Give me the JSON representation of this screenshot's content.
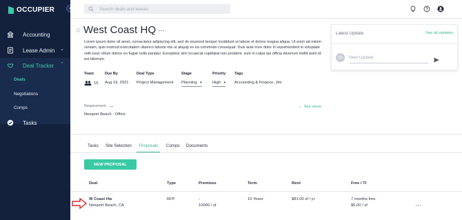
{
  "brand": {
    "name": "OCCUPIER",
    "accent": "#3bc9a5",
    "sidebar_bg": "#13213d"
  },
  "sidebar": {
    "items": [
      {
        "label": "Accounting",
        "icon": "building-icon"
      },
      {
        "label": "Lease Admin",
        "icon": "document-icon"
      },
      {
        "label": "Deal Tracker",
        "icon": "handshake-icon"
      },
      {
        "label": "Tasks",
        "icon": "check-circle-icon"
      }
    ],
    "sub_items": [
      {
        "label": "Deals"
      },
      {
        "label": "Negotiations"
      },
      {
        "label": "Comps"
      }
    ]
  },
  "search": {
    "placeholder": "Search deals and leases"
  },
  "header": {
    "title": "West Coast HQ",
    "description": "Lorem ipsum dolor sit amet, consectetur adipiscing elit, sed do eiusmod tempor incididunt ut labore et dolore magna aliqua. Ut enim ad minim veniam, quis nostrud exercitation ullamco laboris nisi ut aliquip ex ea commodo consequat. Duis aute irure dolor in reprehenderit in voluptate velit esse cillum dolore eu fugiat nulla pariatur. Excepteur sint occaecat cupidatat non proident, sunt in culpa qui officia deserunt mollit anim id est laborum."
  },
  "fields": {
    "team_label": "Team",
    "team_value": "16",
    "due_label": "Due By",
    "due_value": "Aug 19, 2021",
    "type_label": "Deal Type",
    "type_value": "Project Management",
    "stage_label": "Stage",
    "stage_value": "Planning",
    "priority_label": "Priority",
    "priority_value": "High",
    "tags_label": "Tags",
    "tags_value": "Accounting & Finance, Jim"
  },
  "requirement": {
    "label": "Requirement",
    "value": "Newport Beach - Office",
    "see_more": "See more"
  },
  "tabs": [
    {
      "label": "Tasks"
    },
    {
      "label": "Site Selection"
    },
    {
      "label": "Proposals"
    },
    {
      "label": "Comps"
    },
    {
      "label": "Documents"
    }
  ],
  "new_proposal_label": "NEW PROPOSAL",
  "table": {
    "columns": [
      "Deal",
      "Type",
      "Premises",
      "Term",
      "Rent",
      "Free / TI"
    ],
    "row": {
      "deal": "W Coast Hw",
      "location": "Newport Beach, CA",
      "type": "RFP",
      "premises_top": "-",
      "premises": "10000 / sf",
      "term": "10 Years",
      "rent": "$81.00 sf / yr",
      "free": "7 months free",
      "ti": "$5.00 / sf"
    }
  },
  "latest_update": {
    "title": "Latest Update",
    "see_all": "See all updates",
    "avatar": "SS",
    "placeholder": "New Update"
  }
}
